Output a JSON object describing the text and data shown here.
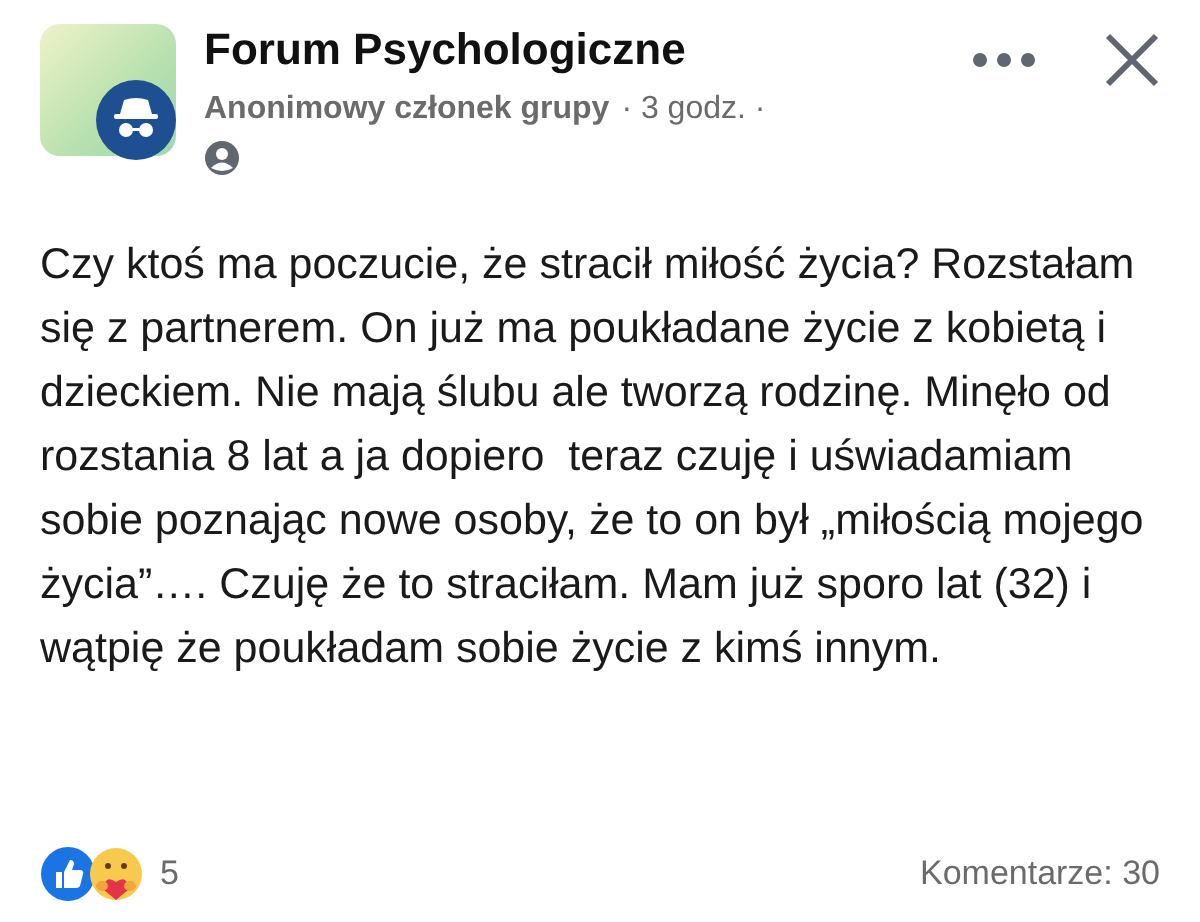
{
  "header": {
    "group_name": "Forum Psychologiczne",
    "author": "Anonimowy członek grupy",
    "time": "· 3 godz. ·"
  },
  "post": {
    "text": "Czy ktoś ma poczucie, że stracił miłość życia? Rozstałam się z partnerem. On już ma poukładane życie z kobietą i dzieckiem. Nie mają ślubu ale tworzą rodzinę. Minęło od rozstania 8 lat a ja dopiero  teraz czuję i uświadamiam sobie poznając nowe osoby, że to on był „miłością mojego życia”…. Czuję że to straciłam. Mam już sporo lat (32) i wątpię że poukładam sobie życie z kimś innym."
  },
  "footer": {
    "reaction_count": "5",
    "comments": "Komentarze: 30"
  }
}
